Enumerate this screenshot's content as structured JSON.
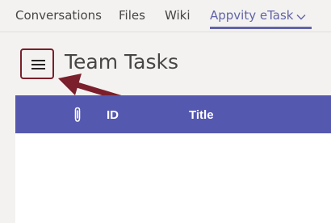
{
  "tabs": [
    {
      "label": "Conversations"
    },
    {
      "label": "Files"
    },
    {
      "label": "Wiki"
    },
    {
      "label": "Appvity eTask"
    }
  ],
  "active_tab": "Appvity eTask",
  "header": {
    "title": "Team Tasks",
    "menu_icon": "hamburger-menu-icon"
  },
  "table": {
    "columns": [
      {
        "label": "",
        "icon": "paperclip-icon"
      },
      {
        "label": "ID"
      },
      {
        "label": "Title"
      }
    ],
    "rows": []
  },
  "colors": {
    "accent": "#6264a7",
    "table_header": "#5558af",
    "highlight_border": "#7a1f2b",
    "arrow": "#7a1f2b"
  }
}
